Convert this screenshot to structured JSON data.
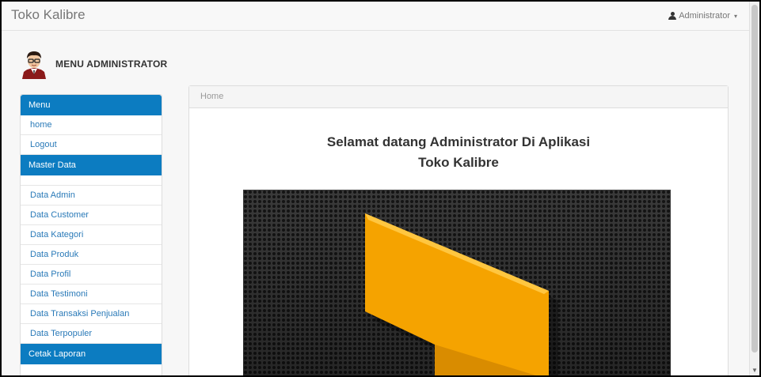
{
  "navbar": {
    "brand": "Toko Kalibre",
    "user_label": "Administrator",
    "user_icon": "user-icon",
    "caret_icon": "caret-down-icon"
  },
  "admin_header": {
    "title": "MENU ADMINISTRATOR",
    "avatar": "admin-avatar"
  },
  "sidebar": {
    "menu_heading": "Menu",
    "menu_items": [
      "home",
      "Logout"
    ],
    "master_heading": "Master Data",
    "master_items": [
      "Data Admin",
      "Data Customer",
      "Data Kategori",
      "Data Produk",
      "Data Profil",
      "Data Testimoni",
      "Data Transaksi Penjualan",
      "Data Terpopuler"
    ],
    "report_heading": "Cetak Laporan"
  },
  "content": {
    "breadcrumb": "Home",
    "welcome_line1": "Selamat datang Administrator Di Aplikasi",
    "welcome_line2": "Toko Kalibre",
    "hero_image": "kalibre-logo-banner"
  },
  "colors": {
    "accent": "#0c7cc1",
    "link": "#2a7ab8",
    "logo_orange": "#f5a300",
    "hero_bg": "#2b2b2b"
  }
}
